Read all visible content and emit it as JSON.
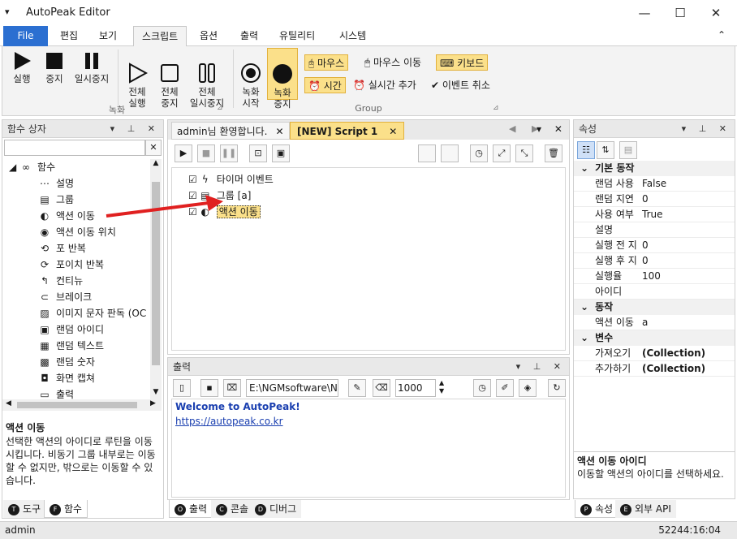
{
  "window": {
    "qat_glyph": "▾",
    "title": "AutoPeak Editor",
    "minimize": "—",
    "maximize": "☐",
    "close": "✕"
  },
  "menu": {
    "tabs": [
      "File",
      "편집",
      "보기",
      "스크립트",
      "옵션",
      "출력",
      "유틸리티",
      "시스템"
    ],
    "active": "스크립트",
    "collapse_glyph": "⌃"
  },
  "ribbon": {
    "buttons": {
      "run": "실행",
      "stop": "중지",
      "pause": "일시중지",
      "run_all": "전체\n실행",
      "stop_all": "전체\n중지",
      "pause_all": "전체\n일시중지",
      "rec_start": "녹화\n시작",
      "rec_stop": "녹화\n중지"
    },
    "small": {
      "mouse": "마우스",
      "mouse_move": "마우스 이동",
      "keyboard": "키보드",
      "time": "시간",
      "realtime_add": "실시간 추가",
      "event_cancel": "이벤트 취소"
    },
    "group_record": "녹화",
    "group_group": "Group"
  },
  "left_panel": {
    "title": "함수 상자",
    "search_value": "",
    "clear_glyph": "✕",
    "root": "함수",
    "items": [
      {
        "label": "설명",
        "icon": "ellipsis-circle-icon",
        "glyph": "⋯"
      },
      {
        "label": "그룹",
        "icon": "group-icon",
        "glyph": "▤"
      },
      {
        "label": "액션 이동",
        "icon": "action-move-icon",
        "glyph": "◐"
      },
      {
        "label": "액션 이동 위치",
        "icon": "action-position-icon",
        "glyph": "◉"
      },
      {
        "label": "포 반복",
        "icon": "for-loop-icon",
        "glyph": "⟲"
      },
      {
        "label": "포이치 반복",
        "icon": "foreach-loop-icon",
        "glyph": "⟳"
      },
      {
        "label": "컨티뉴",
        "icon": "continue-icon",
        "glyph": "↰"
      },
      {
        "label": "브레이크",
        "icon": "break-icon",
        "glyph": "⊂"
      },
      {
        "label": "이미지 문자 판독 (OC",
        "icon": "ocr-icon",
        "glyph": "▨"
      },
      {
        "label": "랜덤 아이디",
        "icon": "random-id-icon",
        "glyph": "▣"
      },
      {
        "label": "랜덤 텍스트",
        "icon": "random-text-icon",
        "glyph": "▦"
      },
      {
        "label": "랜덤 숫자",
        "icon": "random-number-icon",
        "glyph": "▩"
      },
      {
        "label": "화면 캡쳐",
        "icon": "screen-capture-icon",
        "glyph": "◘"
      },
      {
        "label": "출력",
        "icon": "output-icon",
        "glyph": "▭"
      }
    ],
    "desc_title": "액션 이동",
    "desc_text": "선택한 액션의 아이디로 루틴을 이동시킵니다. 비동기 그룹 내부로는 이동할 수 없지만, 밖으로는 이동할 수 있습니다.",
    "tabs": [
      {
        "badge": "T",
        "label": "도구"
      },
      {
        "badge": "F",
        "label": "함수"
      }
    ]
  },
  "editor": {
    "tabs": [
      {
        "label": "admin님 환영합니다."
      },
      {
        "label": "[NEW] Script 1"
      }
    ],
    "nodes": [
      {
        "label": "타이머 이벤트",
        "icon": "lightning-icon",
        "glyph": "ϟ"
      },
      {
        "label": "그룹 [a]",
        "icon": "group-icon",
        "glyph": "▤"
      },
      {
        "label": "액션 이동",
        "icon": "action-move-icon",
        "glyph": "◐"
      }
    ]
  },
  "output": {
    "title": "출력",
    "path": "E:\\NGMsoftware\\NG",
    "count": "1000",
    "lines": [
      "Welcome to AutoPeak!",
      "https://autopeak.co.kr"
    ],
    "tabs": [
      {
        "badge": "O",
        "label": "출력"
      },
      {
        "badge": "C",
        "label": "콘솔"
      },
      {
        "badge": "D",
        "label": "디버그"
      }
    ]
  },
  "properties": {
    "title": "속성",
    "categories": [
      {
        "name": "기본 동작",
        "rows": [
          {
            "name": "랜덤 사용",
            "value": "False"
          },
          {
            "name": "랜덤 지연",
            "value": "0"
          },
          {
            "name": "사용 여부",
            "value": "True"
          },
          {
            "name": "설명",
            "value": ""
          },
          {
            "name": "실행 전 지",
            "value": "0"
          },
          {
            "name": "실행 후 지",
            "value": "0"
          },
          {
            "name": "실행율",
            "value": "100"
          },
          {
            "name": "아이디",
            "value": ""
          }
        ]
      },
      {
        "name": "동작",
        "rows": [
          {
            "name": "액션 이동",
            "value": "a"
          }
        ]
      },
      {
        "name": "변수",
        "rows": [
          {
            "name": "가져오기",
            "value": "(Collection)"
          },
          {
            "name": "추가하기",
            "value": "(Collection)"
          }
        ]
      }
    ],
    "desc_title": "액션 이동 아이디",
    "desc_text": "이동할 액션의 아이디를 선택하세요.",
    "tabs": [
      {
        "badge": "P",
        "label": "속성"
      },
      {
        "badge": "E",
        "label": "외부 API"
      }
    ]
  },
  "status": {
    "user": "admin",
    "time": "52244:16:04"
  },
  "colors": {
    "accent": "#2b6fd1",
    "highlight": "#fbe08a",
    "link": "#1a3fb0",
    "arrow": "#e02020"
  }
}
